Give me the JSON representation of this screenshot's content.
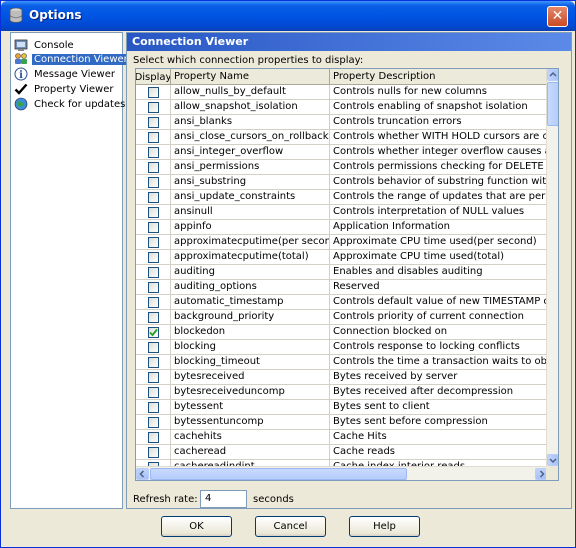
{
  "window": {
    "title": "Options",
    "close_label": "✕"
  },
  "nav": {
    "items": [
      {
        "label": "Console",
        "icon": "console-icon",
        "selected": false
      },
      {
        "label": "Connection Viewer",
        "icon": "connection-viewer-icon",
        "selected": true
      },
      {
        "label": "Message Viewer",
        "icon": "message-viewer-icon",
        "selected": false
      },
      {
        "label": "Property Viewer",
        "icon": "checkmark-icon",
        "selected": false
      },
      {
        "label": "Check for updates",
        "icon": "globe-icon",
        "selected": false
      }
    ]
  },
  "panel": {
    "title": "Connection Viewer",
    "instruction": "Select which connection properties to display:"
  },
  "table": {
    "columns": [
      "Display",
      "Property Name",
      "Property Description"
    ],
    "rows": [
      {
        "checked": false,
        "name": "allow_nulls_by_default",
        "desc": "Controls nulls for new columns"
      },
      {
        "checked": false,
        "name": "allow_snapshot_isolation",
        "desc": "Controls enabling of snapshot isolation"
      },
      {
        "checked": false,
        "name": "ansi_blanks",
        "desc": "Controls truncation errors"
      },
      {
        "checked": false,
        "name": "ansi_close_cursors_on_rollback",
        "desc": "Controls whether WITH HOLD cursors are closed on"
      },
      {
        "checked": false,
        "name": "ansi_integer_overflow",
        "desc": "Controls whether integer overflow causes an error"
      },
      {
        "checked": false,
        "name": "ansi_permissions",
        "desc": "Controls permissions checking for DELETE and UPDA"
      },
      {
        "checked": false,
        "name": "ansi_substring",
        "desc": "Controls behavior of substring function with negati"
      },
      {
        "checked": false,
        "name": "ansi_update_constraints",
        "desc": "Controls the range of updates that are permitted"
      },
      {
        "checked": false,
        "name": "ansinull",
        "desc": "Controls interpretation of NULL values"
      },
      {
        "checked": false,
        "name": "appinfo",
        "desc": "Application Information"
      },
      {
        "checked": false,
        "name": "approximatecputime(per second)",
        "desc": "Approximate CPU time used(per second)"
      },
      {
        "checked": false,
        "name": "approximatecputime(total)",
        "desc": "Approximate CPU time used(total)"
      },
      {
        "checked": false,
        "name": "auditing",
        "desc": "Enables and disables auditing"
      },
      {
        "checked": false,
        "name": "auditing_options",
        "desc": "Reserved"
      },
      {
        "checked": false,
        "name": "automatic_timestamp",
        "desc": "Controls default value of new TIMESTAMP columns"
      },
      {
        "checked": false,
        "name": "background_priority",
        "desc": "Controls priority of current connection"
      },
      {
        "checked": true,
        "name": "blockedon",
        "desc": "Connection blocked on"
      },
      {
        "checked": false,
        "name": "blocking",
        "desc": "Controls response to locking conflicts"
      },
      {
        "checked": false,
        "name": "blocking_timeout",
        "desc": "Controls the time a transaction waits to obtain a loc"
      },
      {
        "checked": false,
        "name": "bytesreceived",
        "desc": "Bytes received by server"
      },
      {
        "checked": false,
        "name": "bytesreceiveduncomp",
        "desc": "Bytes received after decompression"
      },
      {
        "checked": false,
        "name": "bytessent",
        "desc": "Bytes sent to client"
      },
      {
        "checked": false,
        "name": "bytessentuncomp",
        "desc": "Bytes sent before compression"
      },
      {
        "checked": false,
        "name": "cachehits",
        "desc": "Cache Hits"
      },
      {
        "checked": false,
        "name": "cacheread",
        "desc": "Cache reads"
      },
      {
        "checked": false,
        "name": "cachereadindint",
        "desc": "Cache index interior reads"
      }
    ]
  },
  "refresh": {
    "label": "Refresh rate:",
    "value": "4",
    "unit": "seconds"
  },
  "buttons": {
    "ok": "OK",
    "cancel": "Cancel",
    "help": "Help"
  },
  "colors": {
    "title_bar": "#0054e3",
    "selection": "#316ac5",
    "check": "#21a121",
    "dialog_bg": "#ece9d8"
  }
}
